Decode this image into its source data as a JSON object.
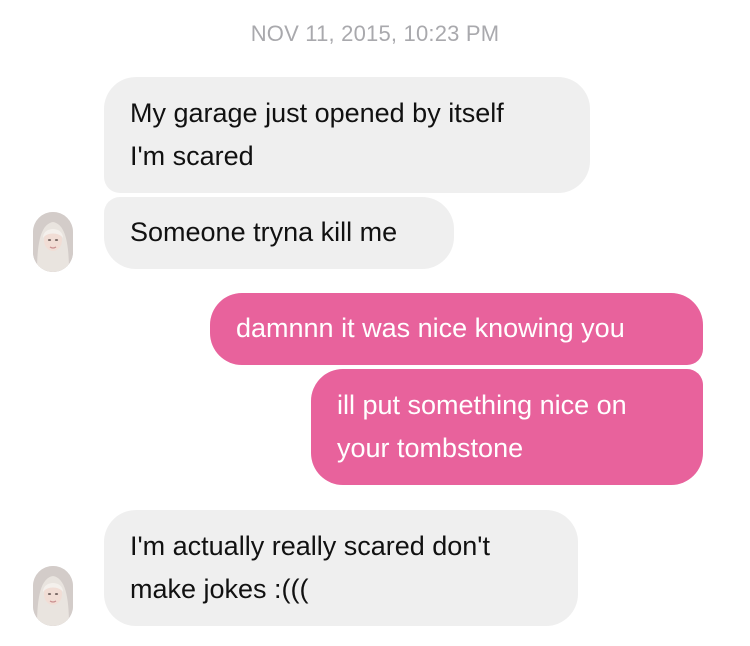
{
  "conversation": {
    "timestamp": "NOV 11, 2015, 10:23 PM",
    "messages": [
      {
        "direction": "incoming",
        "lines": [
          "My garage just opened by itself",
          "I'm scared"
        ]
      },
      {
        "direction": "incoming",
        "lines": [
          "Someone tryna kill me"
        ]
      },
      {
        "direction": "outgoing",
        "lines": [
          "damnnn it was nice knowing you"
        ]
      },
      {
        "direction": "outgoing",
        "lines": [
          "ill put something nice on",
          "your tombstone"
        ]
      },
      {
        "direction": "incoming",
        "lines": [
          "I'm actually really scared don't",
          "make jokes :((("
        ]
      }
    ]
  },
  "colors": {
    "incoming_bubble": "#efefef",
    "outgoing_bubble": "#e8629c",
    "timestamp_text": "#a9a9ad"
  },
  "icons": {
    "contact_avatar": "avatar"
  }
}
